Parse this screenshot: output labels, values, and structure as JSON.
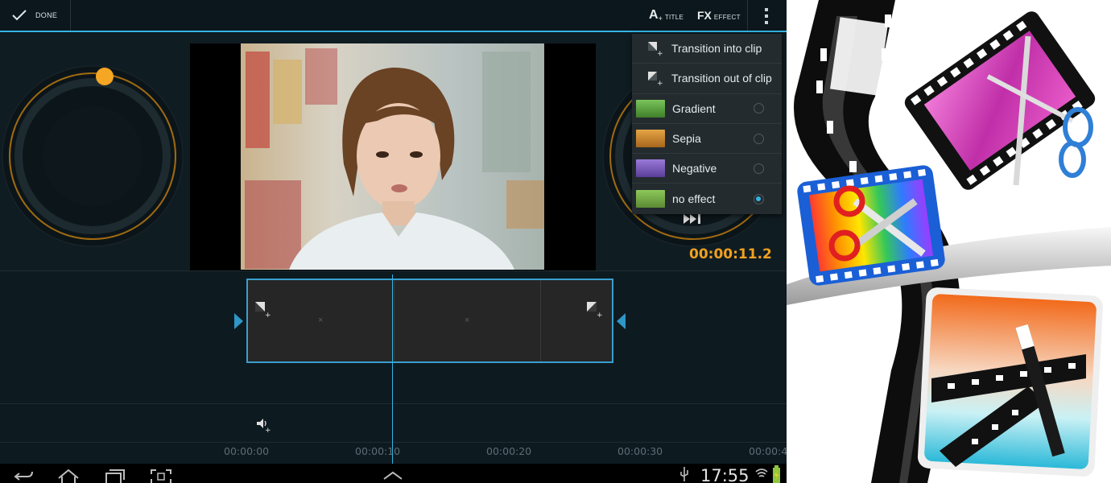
{
  "action_bar": {
    "done_label": "DONE",
    "title_button": {
      "glyph": "A",
      "label": "TITLE"
    },
    "effect_button": {
      "glyph": "FX",
      "label": "EFFECT"
    }
  },
  "preview": {
    "timecode": "00:00:11.2"
  },
  "fx_menu": {
    "items": [
      {
        "label": "Transition into clip",
        "icon": "transition-in-icon"
      },
      {
        "label": "Transition out of clip",
        "icon": "transition-out-icon"
      },
      {
        "label": "Gradient",
        "thumb_color": "#5aa23a",
        "selected": false
      },
      {
        "label": "Sepia",
        "thumb_color": "#c98a2c",
        "selected": false
      },
      {
        "label": "Negative",
        "thumb_color": "#7a5ab8",
        "selected": false
      },
      {
        "label": "no effect",
        "thumb_color": "#6fae3c",
        "selected": true
      }
    ]
  },
  "timeline": {
    "ticks": [
      "00:00:00",
      "00:00:10",
      "00:00:20",
      "00:00:30",
      "00:00:4"
    ]
  },
  "status_bar": {
    "clock": "17:55"
  },
  "colors": {
    "accent": "#33b5e5",
    "timecode": "#f0a020",
    "jog_ring": "#a06a10",
    "jog_knob": "#f5a623"
  }
}
